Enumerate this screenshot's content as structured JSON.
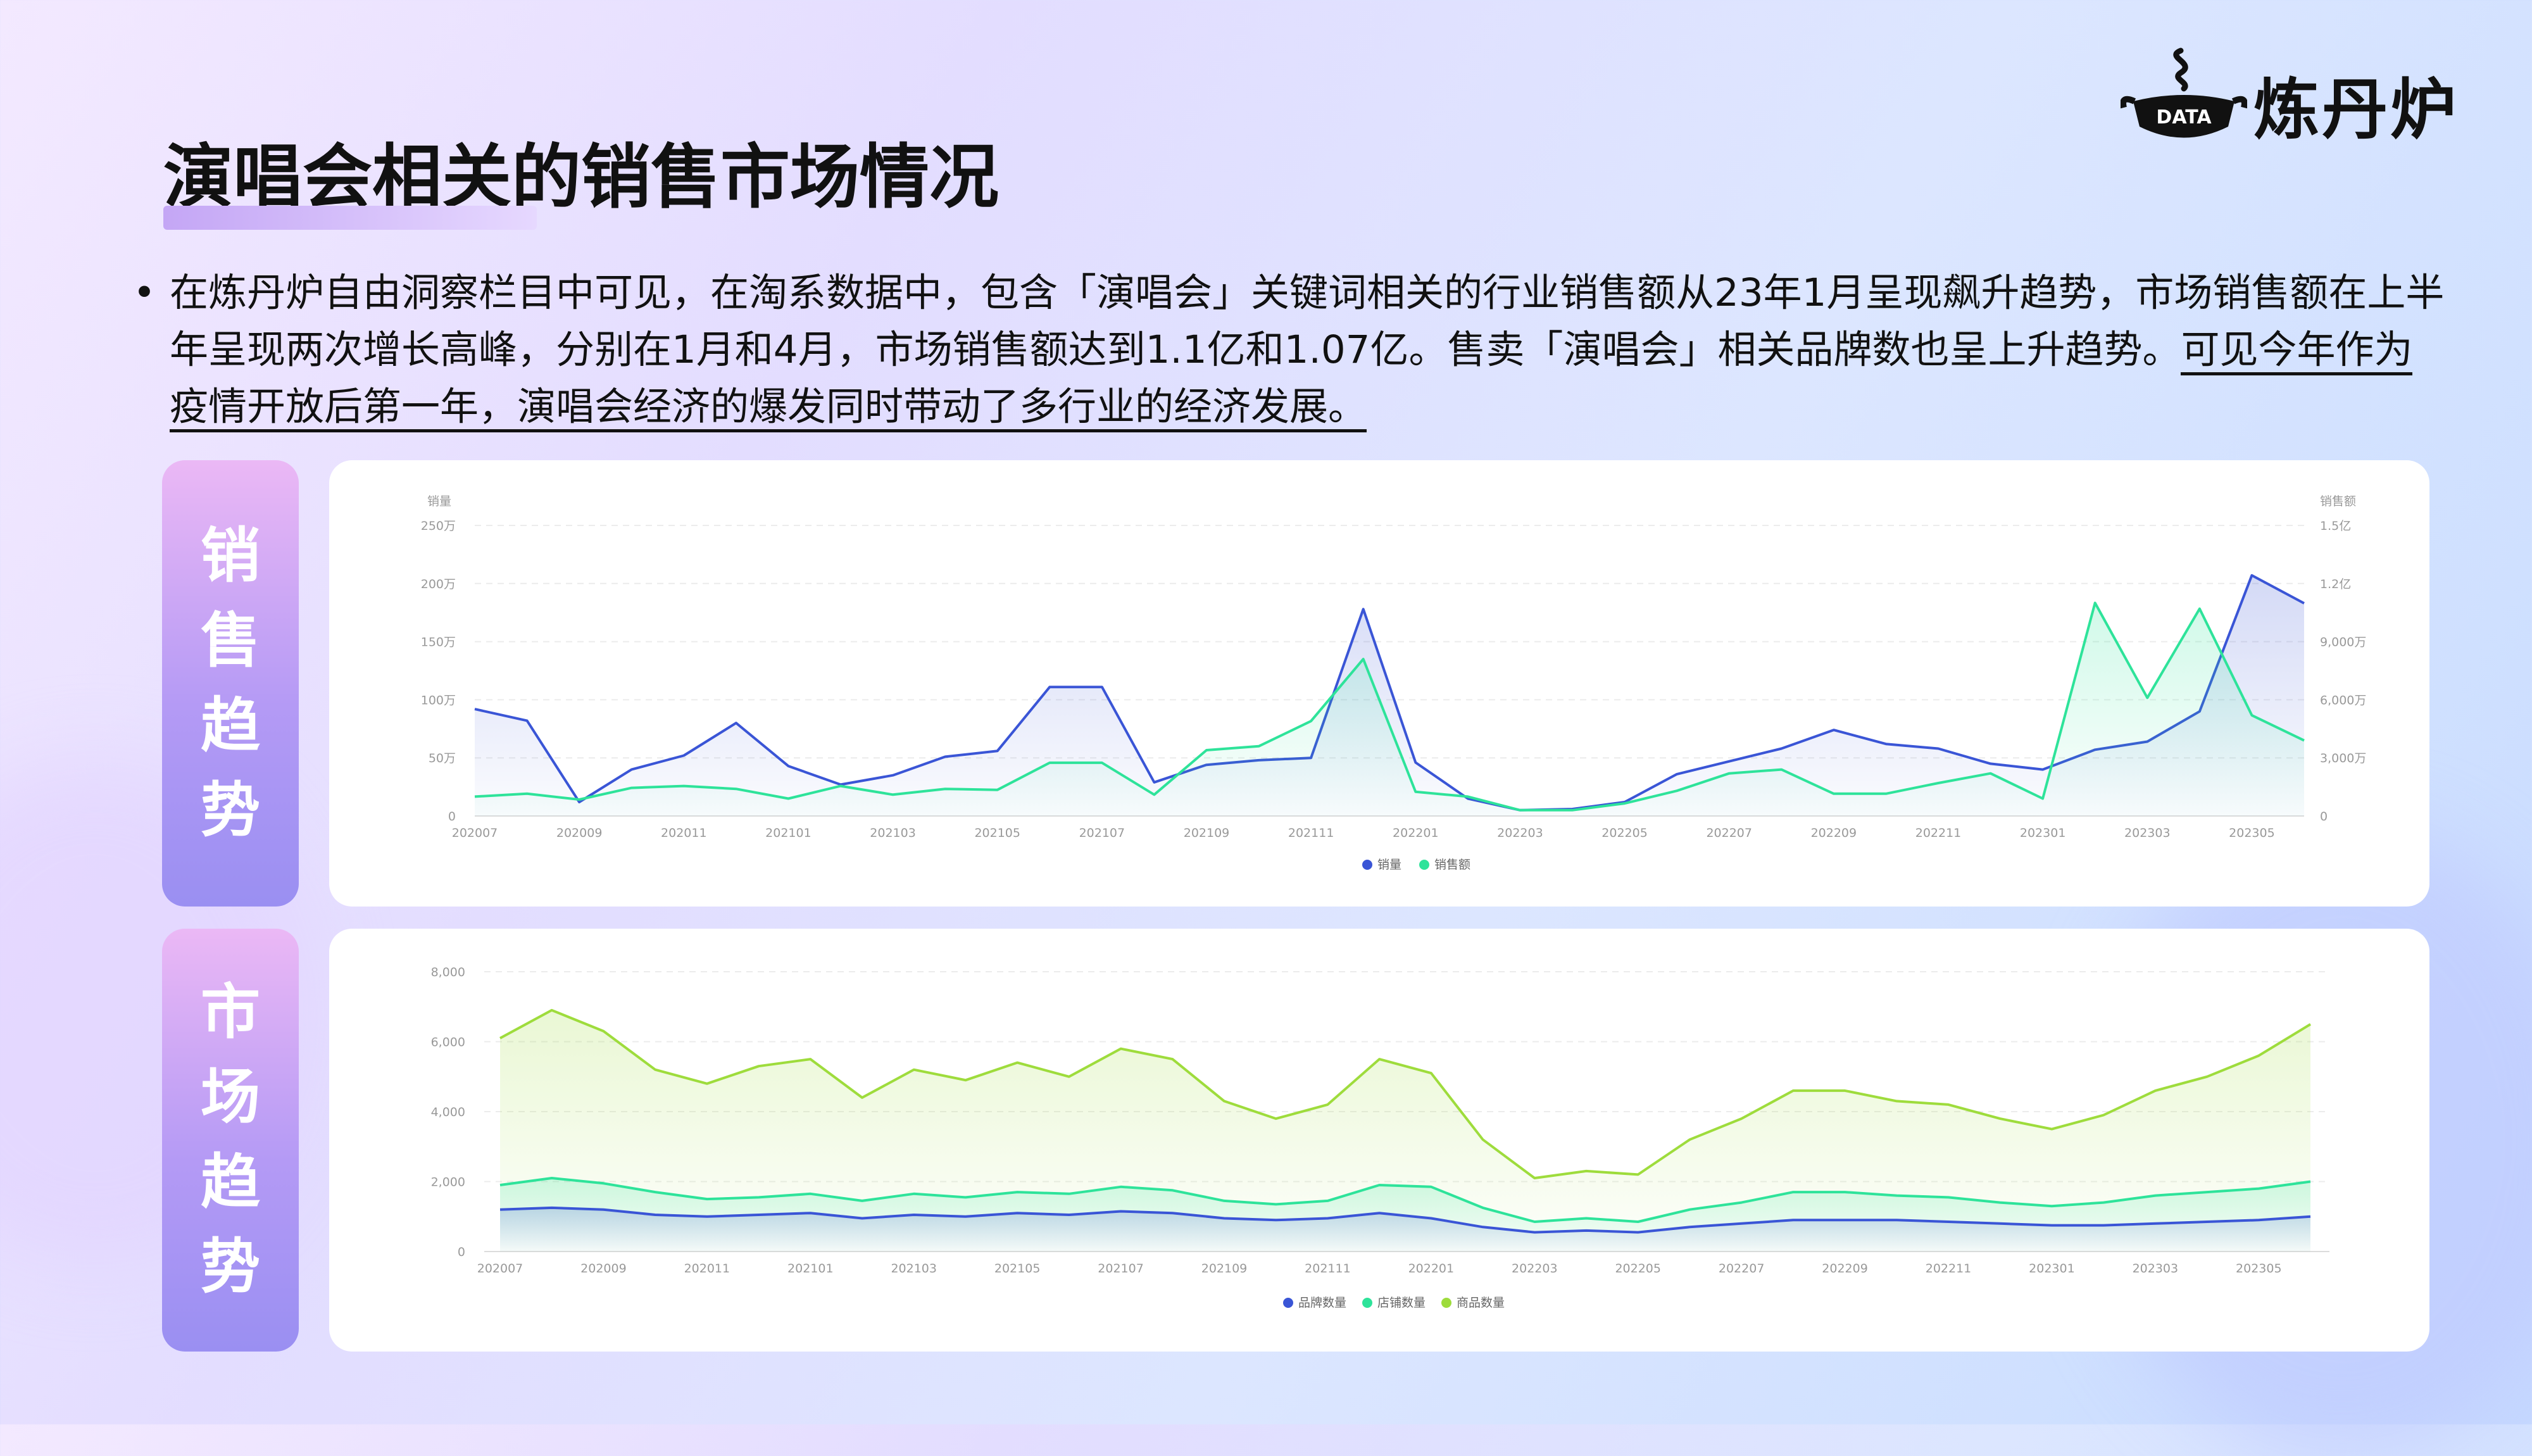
{
  "header": {
    "logo_badge": "DATA",
    "logo_text": "炼丹炉",
    "title": "演唱会相关的销售市场情况"
  },
  "description": {
    "bullet": "•",
    "text_plain": "在炼丹炉自由洞察栏目中可见，在淘系数据中，包含「演唱会」关键词相关的行业销售额从23年1月呈现飙升趋势，市场销售额在上半年呈现两次增长高峰，分别在1月和4月，市场销售额达到1.1亿和1.07亿。售卖「演唱会」相关品牌数也呈上升趋势。",
    "text_underlined": "可见今年作为疫情开放后第一年，演唱会经济的爆发同时带动了多行业的经济发展。"
  },
  "side_tabs": {
    "sales": [
      "销",
      "售",
      "趋",
      "势"
    ],
    "market": [
      "市",
      "场",
      "趋",
      "势"
    ]
  },
  "colors": {
    "blue": "#3a55d6",
    "teal": "#2ee39a",
    "lime": "#9edc3c"
  },
  "chart_data": [
    {
      "type": "line",
      "y_left_label": "销量",
      "y_right_label": "销售额",
      "y_left_ticks": [
        "0",
        "50万",
        "100万",
        "150万",
        "200万",
        "250万"
      ],
      "y_right_ticks": [
        "0",
        "3,000万",
        "6,000万",
        "9,000万",
        "1.2亿",
        "1.5亿"
      ],
      "ylim_left": [
        0,
        2500000
      ],
      "ylim_right": [
        0,
        150000000
      ],
      "x_ticks": [
        "202007",
        "202009",
        "202011",
        "202101",
        "202103",
        "202105",
        "202107",
        "202109",
        "202111",
        "202201",
        "202203",
        "202205",
        "202207",
        "202209",
        "202211",
        "202301",
        "202303",
        "202305"
      ],
      "x": [
        "202007",
        "202008",
        "202009",
        "202010",
        "202011",
        "202012",
        "202101",
        "202102",
        "202103",
        "202104",
        "202105",
        "202106",
        "202107",
        "202108",
        "202109",
        "202110",
        "202111",
        "202112",
        "202201",
        "202202",
        "202203",
        "202204",
        "202205",
        "202206",
        "202207",
        "202208",
        "202209",
        "202210",
        "202211",
        "202212",
        "202301",
        "202302",
        "202303",
        "202304",
        "202305",
        "202306"
      ],
      "series": [
        {
          "name": "销量",
          "axis": "left",
          "color": "#3a55d6",
          "values": [
            920000,
            820000,
            120000,
            400000,
            520000,
            800000,
            430000,
            270000,
            350000,
            510000,
            560000,
            1110000,
            1110000,
            290000,
            440000,
            480000,
            500000,
            1780000,
            460000,
            150000,
            50000,
            60000,
            120000,
            360000,
            470000,
            580000,
            740000,
            620000,
            580000,
            450000,
            400000,
            570000,
            640000,
            900000,
            2070000,
            1830000
          ]
        },
        {
          "name": "销售额",
          "axis": "right",
          "color": "#2ee39a",
          "values": [
            10000000,
            11500000,
            8500000,
            14500000,
            15500000,
            14000000,
            9000000,
            15500000,
            11000000,
            14000000,
            13500000,
            27500000,
            27500000,
            11000000,
            34000000,
            36000000,
            49000000,
            81000000,
            12500000,
            10000000,
            3000000,
            3000000,
            6500000,
            13000000,
            22000000,
            24000000,
            11500000,
            11500000,
            17000000,
            22000000,
            9000000,
            110000000,
            61000000,
            107000000,
            52000000,
            39000000
          ]
        }
      ]
    },
    {
      "type": "area",
      "y_ticks": [
        "0",
        "2,000",
        "4,000",
        "6,000",
        "8,000"
      ],
      "ylim": [
        0,
        8000
      ],
      "x_ticks": [
        "202007",
        "202009",
        "202011",
        "202101",
        "202103",
        "202105",
        "202107",
        "202109",
        "202111",
        "202201",
        "202203",
        "202205",
        "202207",
        "202209",
        "202211",
        "202301",
        "202303",
        "202305"
      ],
      "x": [
        "202007",
        "202008",
        "202009",
        "202010",
        "202011",
        "202012",
        "202101",
        "202102",
        "202103",
        "202104",
        "202105",
        "202106",
        "202107",
        "202108",
        "202109",
        "202110",
        "202111",
        "202112",
        "202201",
        "202202",
        "202203",
        "202204",
        "202205",
        "202206",
        "202207",
        "202208",
        "202209",
        "202210",
        "202211",
        "202212",
        "202301",
        "202302",
        "202303",
        "202304",
        "202305",
        "202306"
      ],
      "series": [
        {
          "name": "品牌数量",
          "color": "#3a55d6",
          "values": [
            1200,
            1250,
            1200,
            1050,
            1000,
            1050,
            1100,
            950,
            1050,
            1000,
            1100,
            1050,
            1150,
            1100,
            950,
            900,
            950,
            1100,
            950,
            700,
            550,
            600,
            550,
            700,
            800,
            900,
            900,
            900,
            850,
            800,
            750,
            750,
            800,
            850,
            900,
            1000
          ]
        },
        {
          "name": "店铺数量",
          "color": "#2ee39a",
          "values": [
            1900,
            2100,
            1950,
            1700,
            1500,
            1550,
            1650,
            1450,
            1650,
            1550,
            1700,
            1650,
            1850,
            1750,
            1450,
            1350,
            1450,
            1900,
            1850,
            1250,
            850,
            950,
            850,
            1200,
            1400,
            1700,
            1700,
            1600,
            1550,
            1400,
            1300,
            1400,
            1600,
            1700,
            1800,
            2000
          ]
        },
        {
          "name": "商品数量",
          "color": "#9edc3c",
          "values": [
            6100,
            6900,
            6300,
            5200,
            4800,
            5300,
            5500,
            4400,
            5200,
            4900,
            5400,
            5000,
            5800,
            5500,
            4300,
            3800,
            4200,
            5500,
            5100,
            3200,
            2100,
            2300,
            2200,
            3200,
            3800,
            4600,
            4600,
            4300,
            4200,
            3800,
            3500,
            3900,
            4600,
            5000,
            5600,
            6500
          ]
        }
      ]
    }
  ]
}
